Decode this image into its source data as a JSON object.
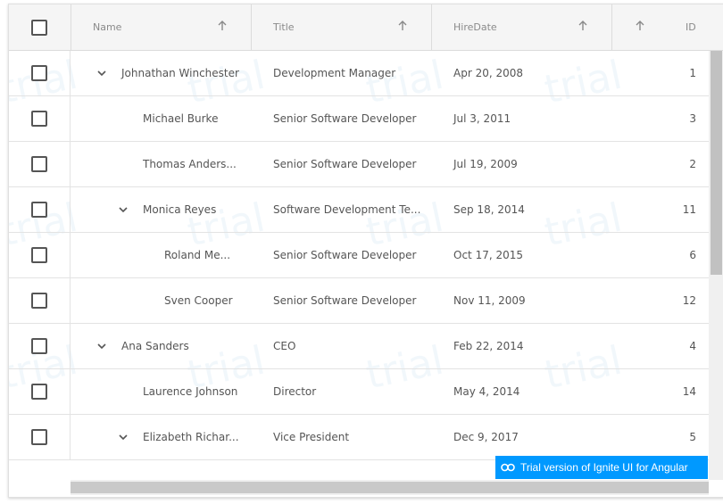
{
  "columns": {
    "name": "Name",
    "title": "Title",
    "hire_date": "HireDate",
    "id": "ID"
  },
  "rows": [
    {
      "name": "Johnathan Winchester",
      "title": "Development Manager",
      "hire_date": "Apr 20, 2008",
      "id": "1",
      "level": 0,
      "expandable": true
    },
    {
      "name": "Michael Burke",
      "title": "Senior Software Developer",
      "hire_date": "Jul 3, 2011",
      "id": "3",
      "level": 1,
      "expandable": false
    },
    {
      "name": "Thomas Anders...",
      "title": "Senior Software Developer",
      "hire_date": "Jul 19, 2009",
      "id": "2",
      "level": 1,
      "expandable": false
    },
    {
      "name": "Monica Reyes",
      "title": "Software Development Te...",
      "hire_date": "Sep 18, 2014",
      "id": "11",
      "level": 1,
      "expandable": true
    },
    {
      "name": "Roland Me...",
      "title": "Senior Software Developer",
      "hire_date": "Oct 17, 2015",
      "id": "6",
      "level": 2,
      "expandable": false
    },
    {
      "name": "Sven Cooper",
      "title": "Senior Software Developer",
      "hire_date": "Nov 11, 2009",
      "id": "12",
      "level": 2,
      "expandable": false
    },
    {
      "name": "Ana Sanders",
      "title": "CEO",
      "hire_date": "Feb 22, 2014",
      "id": "4",
      "level": 0,
      "expandable": true
    },
    {
      "name": "Laurence Johnson",
      "title": "Director",
      "hire_date": "May 4, 2014",
      "id": "14",
      "level": 1,
      "expandable": false
    },
    {
      "name": "Elizabeth Richar...",
      "title": "Vice President",
      "hire_date": "Dec 9, 2017",
      "id": "5",
      "level": 1,
      "expandable": true
    }
  ],
  "watermark_text": "trial",
  "trial_badge": "Trial version of Ignite UI for Angular",
  "colors": {
    "badge": "#0099ff",
    "header_bg": "#f5f5f5"
  }
}
